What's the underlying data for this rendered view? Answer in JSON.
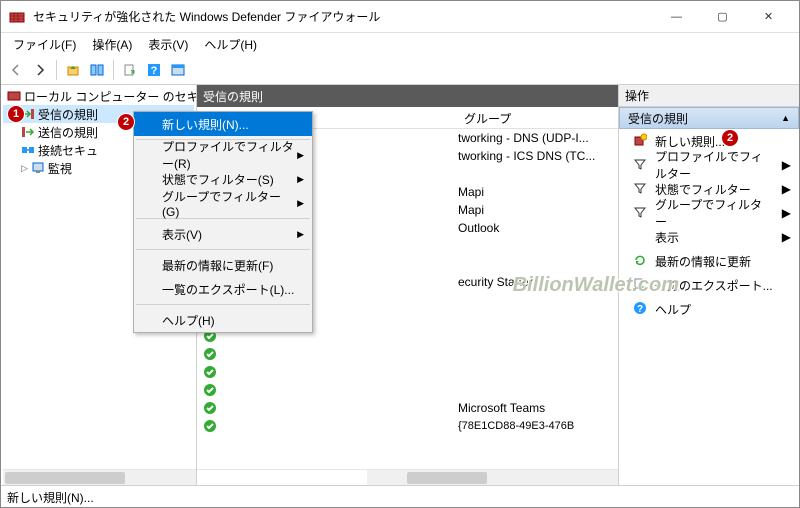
{
  "window": {
    "title": "セキュリティが強化された Windows Defender ファイアウォール"
  },
  "menubar": {
    "file": "ファイル(F)",
    "action": "操作(A)",
    "view": "表示(V)",
    "help": "ヘルプ(H)"
  },
  "tree": {
    "root": "ローカル コンピューター のセキュリティ",
    "inbound": "受信の規則",
    "outbound": "送信の規則",
    "connsec": "接続セキュ",
    "monitor": "監視"
  },
  "center": {
    "header": "受信の規則",
    "col_group": "グループ",
    "rows": [
      {
        "text": "tworking - DNS (UDP-I..."
      },
      {
        "text": "tworking - ICS DNS (TC..."
      },
      {
        "text": ""
      },
      {
        "text": "Mapi"
      },
      {
        "text": "Mapi"
      },
      {
        "text": "Outlook"
      },
      {
        "text": ""
      },
      {
        "text": ""
      },
      {
        "text": "ecurity Starter"
      },
      {
        "text": ""
      },
      {
        "text": ""
      },
      {
        "text": ""
      },
      {
        "text": ""
      },
      {
        "text": ""
      },
      {
        "text": ""
      },
      {
        "text": "Microsoft Teams"
      }
    ],
    "guid": "{78E1CD88-49E3-476B"
  },
  "context_menu": {
    "new_rule": "新しい規則(N)...",
    "filter_profile": "プロファイルでフィルター(R)",
    "filter_state": "状態でフィルター(S)",
    "filter_group": "グループでフィルター(G)",
    "view": "表示(V)",
    "refresh": "最新の情報に更新(F)",
    "export": "一覧のエクスポート(L)...",
    "help": "ヘルプ(H)"
  },
  "actions": {
    "header": "操作",
    "section": "受信の規則",
    "new_rule": "新しい規則...",
    "filter_profile": "プロファイルでフィルター",
    "filter_state": "状態でフィルター",
    "filter_group": "グループでフィルター",
    "view": "表示",
    "refresh": "最新の情報に更新",
    "export": "一覧のエクスポート...",
    "help": "ヘルプ"
  },
  "statusbar": {
    "text": "新しい規則(N)..."
  },
  "badges": {
    "b1": "1",
    "b2a": "2",
    "b2b": "2"
  },
  "watermark": "BillionWallet.com"
}
